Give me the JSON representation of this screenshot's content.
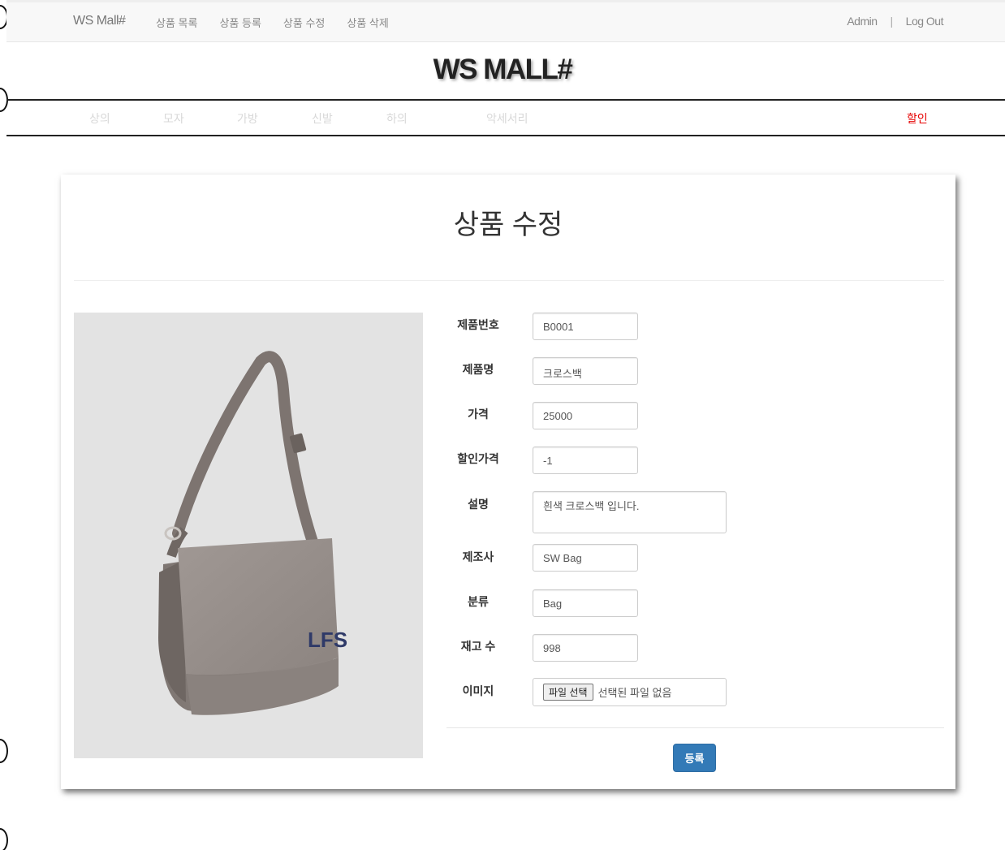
{
  "topnav": {
    "brand": "WS Mall#",
    "menu": [
      "상품 목록",
      "상품 등록",
      "상품 수정",
      "상품 삭제"
    ],
    "user": "Admin",
    "separator": "|",
    "logout": "Log Out"
  },
  "logo": "WS MALL#",
  "categories": [
    "상의",
    "모자",
    "가방",
    "신발",
    "하의",
    "악세서리"
  ],
  "sale_label": "할인",
  "page_title": "상품 수정",
  "product_image": {
    "brand_text": "LFS",
    "description": "gray crossbody bag"
  },
  "form": {
    "labels": {
      "id": "제품번호",
      "name": "제품명",
      "price": "가격",
      "sale_price": "할인가격",
      "description": "설명",
      "manufacturer": "제조사",
      "category": "분류",
      "stock": "재고 수",
      "image": "이미지"
    },
    "values": {
      "id": "B0001",
      "name": "크로스백",
      "price": "25000",
      "sale_price": "-1",
      "description": "흰색 크로스백 입니다.",
      "manufacturer": "SW Bag",
      "category": "Bag",
      "stock": "998"
    },
    "file_button": "파일 선택",
    "file_status": "선택된 파일 없음",
    "submit": "등록"
  },
  "colors": {
    "sale": "#e60000",
    "primary": "#337ab7"
  }
}
